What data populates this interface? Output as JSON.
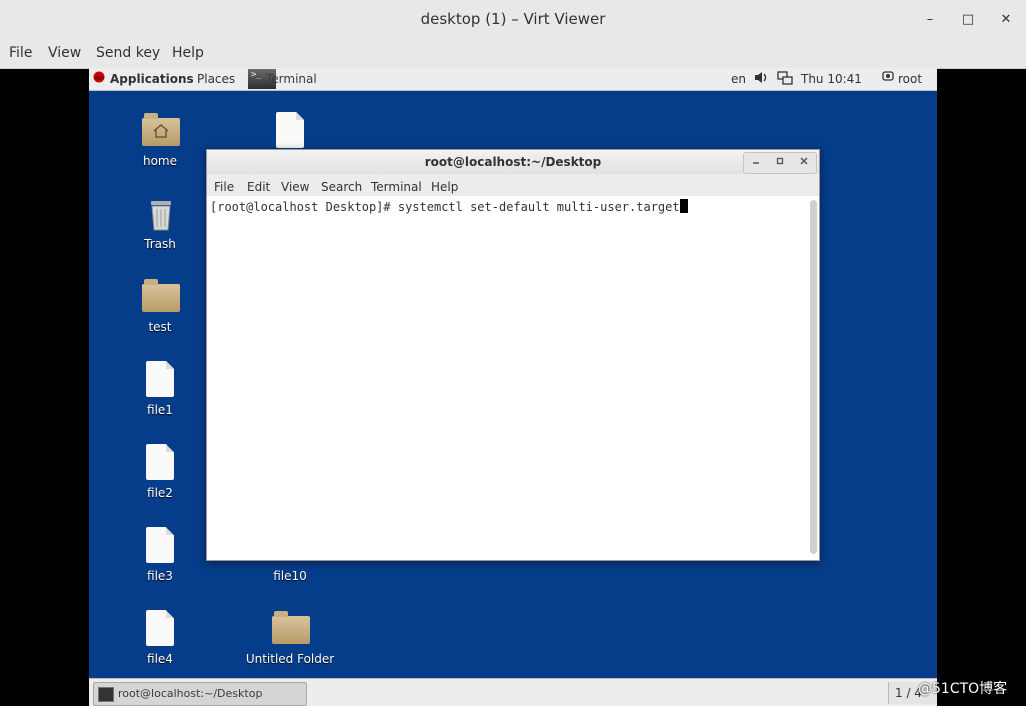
{
  "outer_window": {
    "title": "desktop (1) – Virt Viewer",
    "controls": {
      "minimize": "–",
      "maximize": "□",
      "close": "✕"
    },
    "menu": [
      "File",
      "View",
      "Send key",
      "Help"
    ]
  },
  "guest_topbar": {
    "applications": "Applications",
    "places": "Places",
    "terminal_launcher": "Terminal",
    "language": "en",
    "clock": "Thu 10:41",
    "user": "root",
    "icons": [
      "redhat-logo-icon",
      "volume-icon",
      "network-icon",
      "user-icon"
    ]
  },
  "desktop_icons": {
    "home": "home",
    "trash": "Trash",
    "test": "test",
    "file1": "file1",
    "file2": "file2",
    "file3": "file3",
    "file4": "file4",
    "file10": "file10",
    "untitled_folder": "Untitled Folder"
  },
  "terminal": {
    "title": "root@localhost:~/Desktop",
    "menu": [
      "File",
      "Edit",
      "View",
      "Search",
      "Terminal",
      "Help"
    ],
    "line": "[root@localhost Desktop]# systemctl set-default multi-user.target"
  },
  "bottom_panel": {
    "task_label": "root@localhost:~/Desktop",
    "pager": "1 / 4"
  },
  "watermark": "@51CTO博客"
}
